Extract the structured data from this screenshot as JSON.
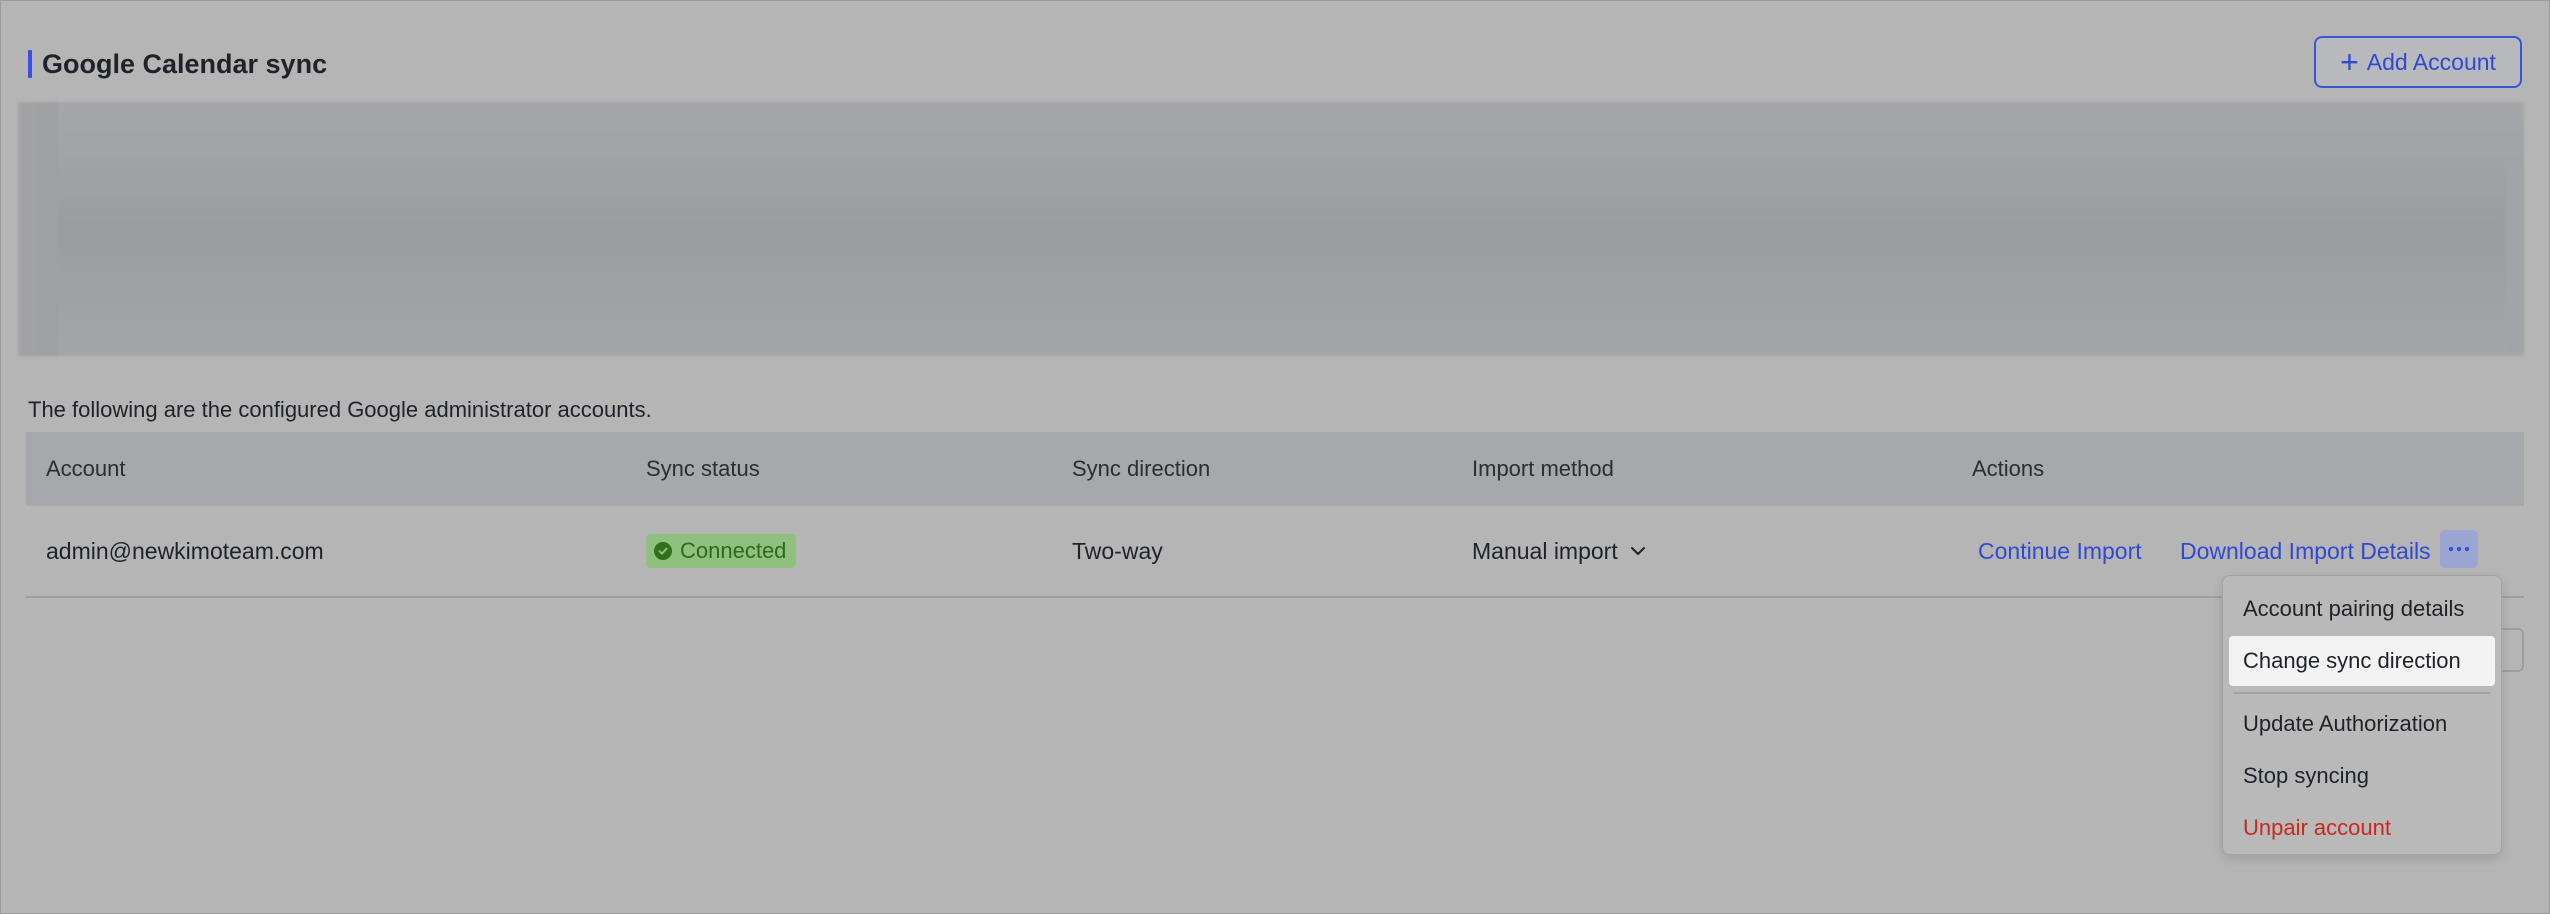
{
  "section": {
    "title": "Google Calendar sync"
  },
  "add_account": {
    "label": "Add Account",
    "icon": "plus-icon"
  },
  "description": "The following are the configured Google administrator accounts.",
  "table": {
    "columns": [
      "Account",
      "Sync status",
      "Sync direction",
      "Import method",
      "Actions"
    ],
    "rows": [
      {
        "account": "admin@newkimoteam.com",
        "status": "Connected",
        "direction": "Two-way",
        "import_method": "Manual import",
        "actions": [
          "Continue Import",
          "Download Import Details"
        ]
      }
    ]
  },
  "menu": {
    "items": [
      "Account pairing details",
      "Change sync direction",
      "Update Authorization",
      "Stop syncing",
      "Unpair account"
    ],
    "highlighted": "Change sync direction"
  },
  "colors": {
    "accent": "#3a4fe6",
    "link": "#2f4ad0",
    "status_connected": "#8fc07d",
    "danger": "#c8281e"
  }
}
